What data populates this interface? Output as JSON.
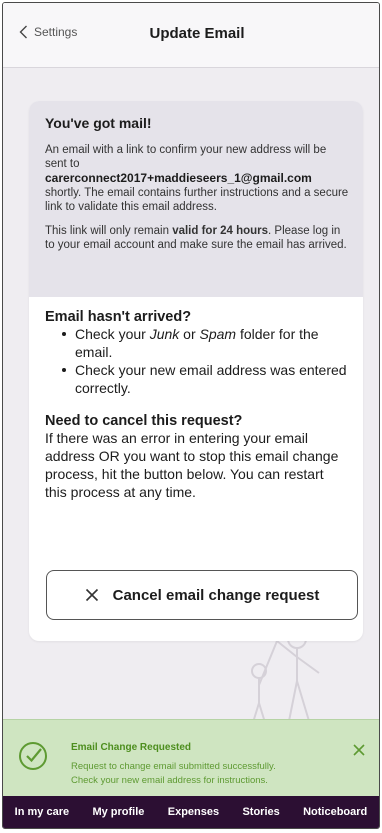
{
  "header": {
    "back_label": "Settings",
    "title": "Update Email"
  },
  "card": {
    "heading": "You've got mail!",
    "intro_pre": "An email with a link to confirm your new address will be sent to",
    "email": "carerconnect2017+maddieseers_1@gmail.com",
    "intro_post": "shortly. The email contains further instructions and a secure link to validate this email address.",
    "validity_pre": "This link will only remain ",
    "validity_bold": "valid for 24 hours",
    "validity_post": ". Please log in to your email account and make sure the email has arrived.",
    "not_arrived_heading": "Email hasn't arrived?",
    "bullet1_pre": "Check your ",
    "bullet1_junk": "Junk",
    "bullet1_mid": " or ",
    "bullet1_spam": "Spam",
    "bullet1_post": " folder for the email.",
    "bullet2": "Check your new email address was entered correctly.",
    "cancel_heading": "Need to cancel this request?",
    "cancel_text": "If there was an error in entering your email address OR you want to stop this email change process, hit the button below. You can restart this process at any time.",
    "cancel_button": "Cancel email change request"
  },
  "toast": {
    "title": "Email Change Requested",
    "line1": "Request to change email submitted successfully.",
    "line2": "Check your new email address for instructions.",
    "color": "#4d8e1e"
  },
  "nav": {
    "items": [
      "In my care",
      "My profile",
      "Expenses",
      "Stories",
      "Noticeboard"
    ]
  },
  "colors": {
    "nav_bg": "#2c0f33",
    "toast_bg": "#cfe5c1",
    "card_top_bg": "#e5e3ea"
  }
}
